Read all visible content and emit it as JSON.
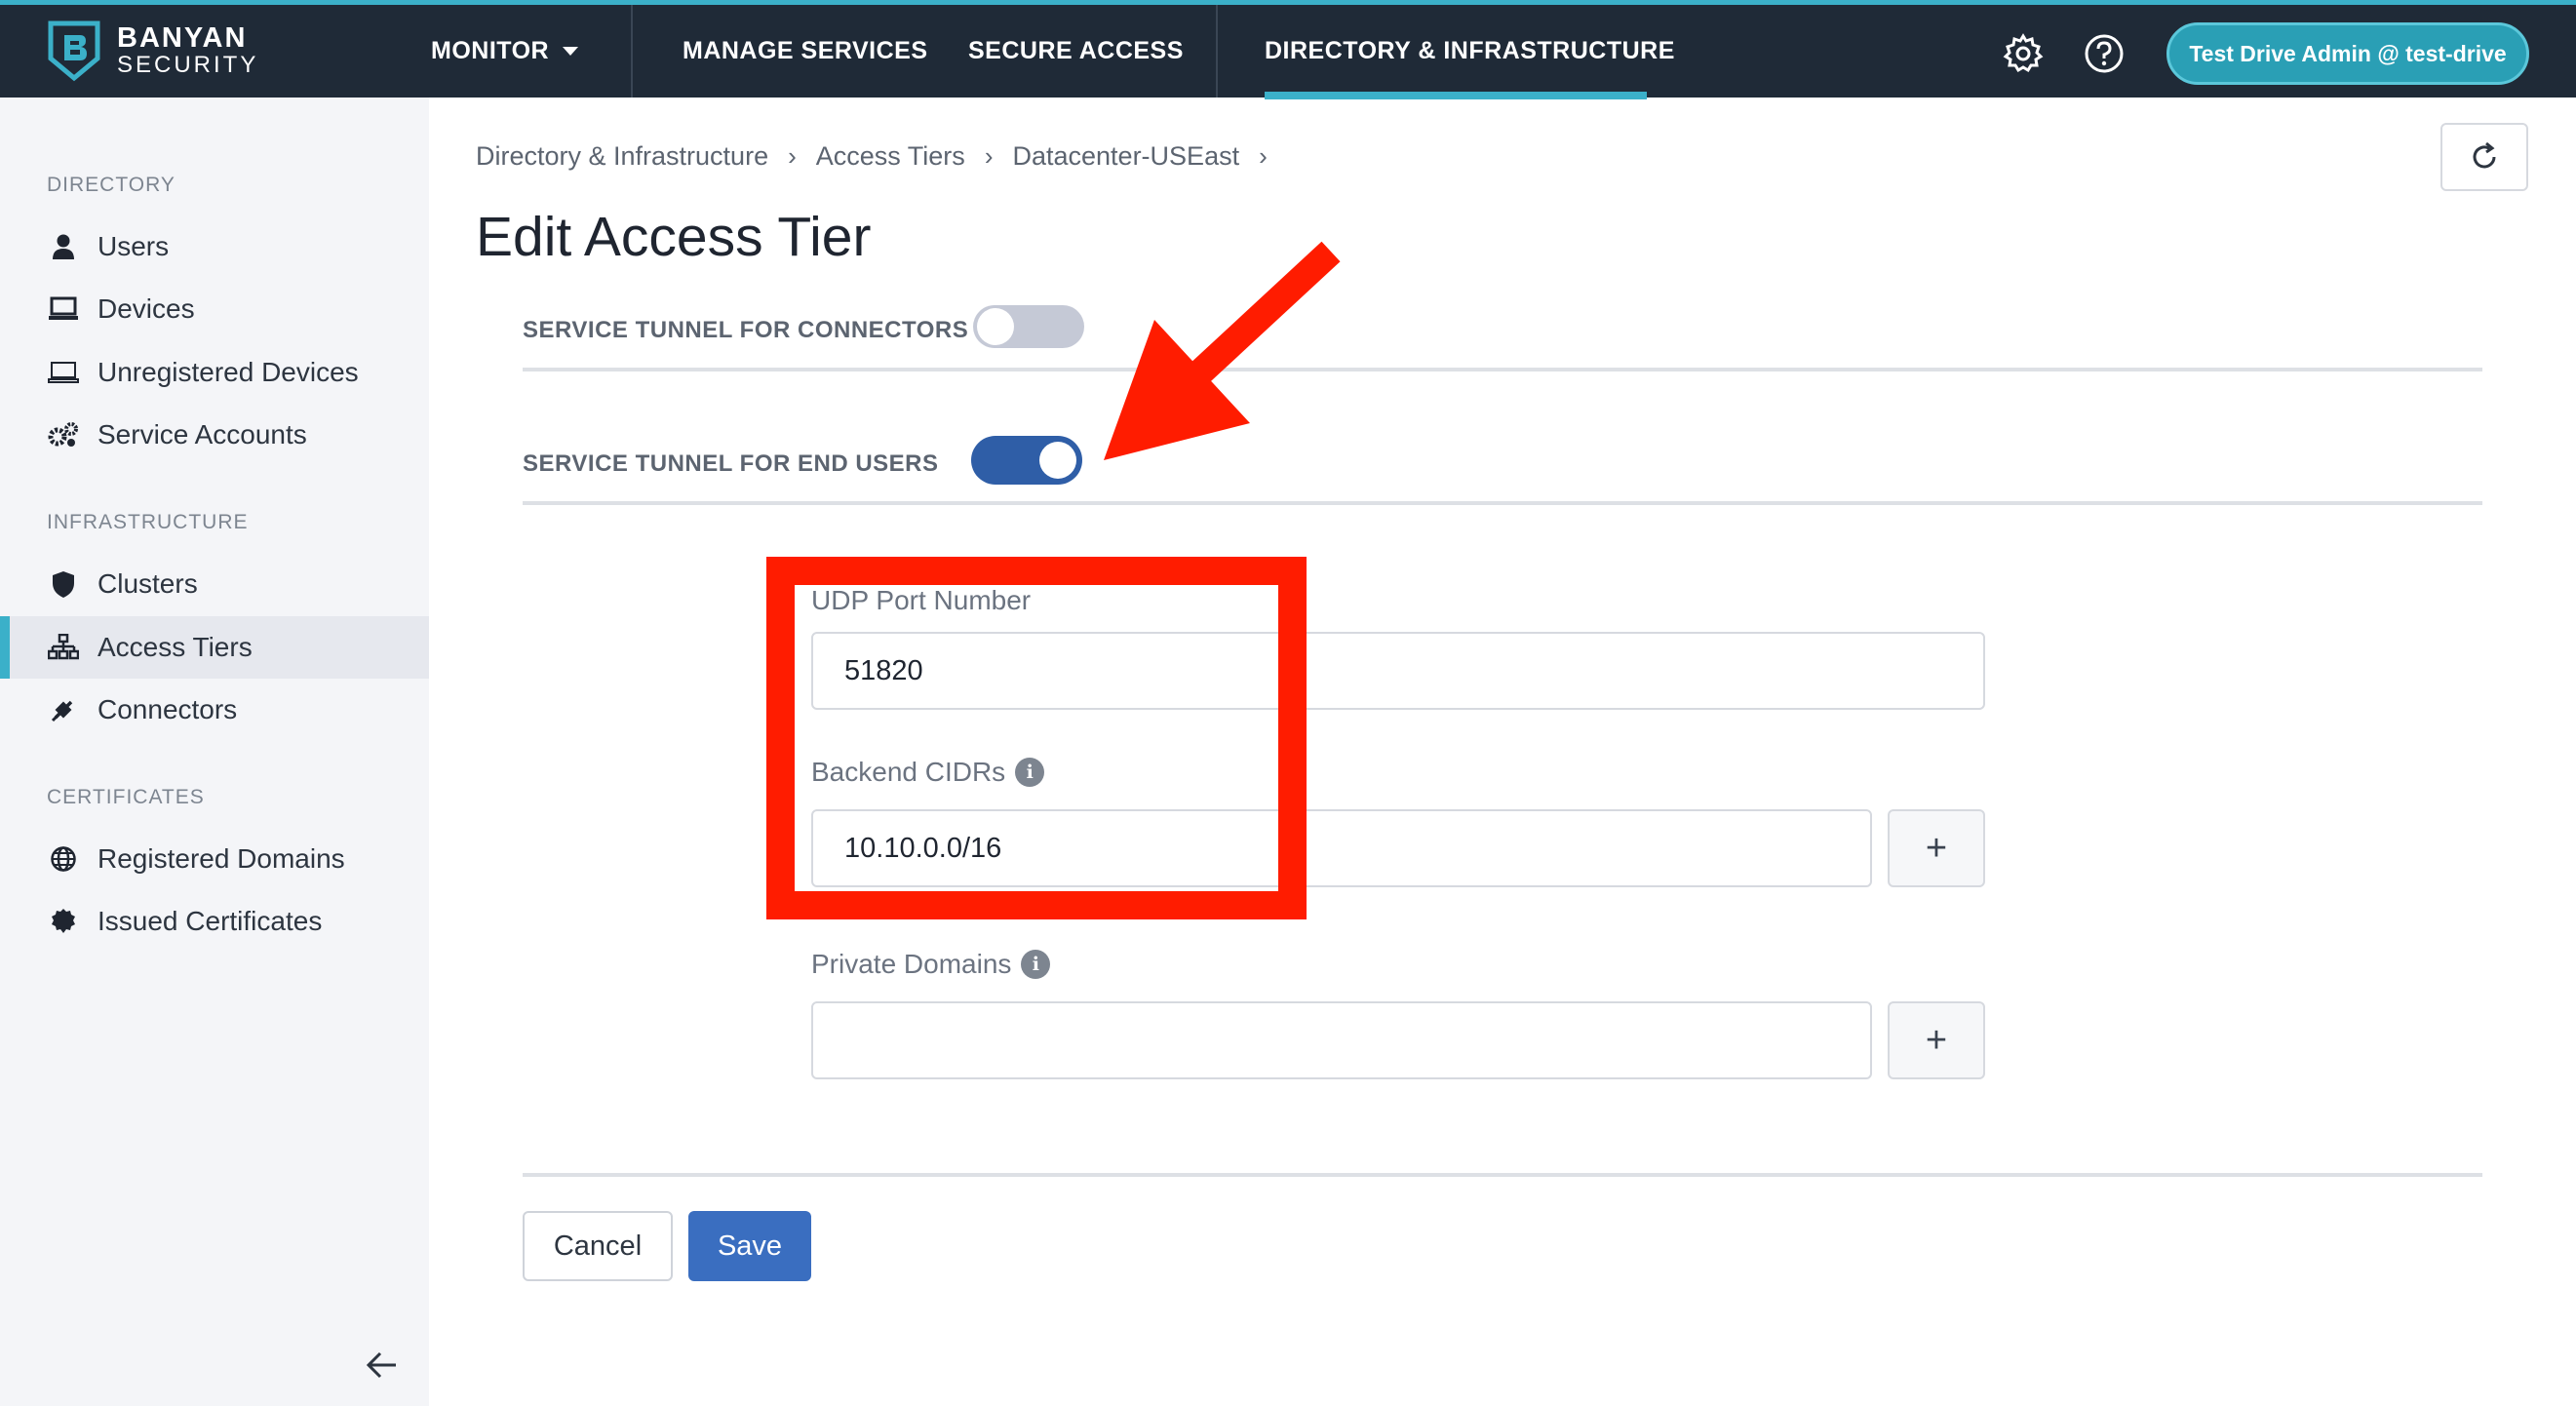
{
  "brand": {
    "line1": "BANYAN",
    "line2": "SECURITY"
  },
  "nav": {
    "monitor": "MONITOR",
    "manage_services": "MANAGE SERVICES",
    "secure_access": "SECURE ACCESS",
    "directory_infrastructure": "DIRECTORY & INFRASTRUCTURE"
  },
  "user": {
    "label": "Test Drive Admin @ test-drive"
  },
  "sidebar": {
    "directory_heading": "DIRECTORY",
    "directory_items": [
      "Users",
      "Devices",
      "Unregistered Devices",
      "Service Accounts"
    ],
    "infrastructure_heading": "INFRASTRUCTURE",
    "infrastructure_items": [
      "Clusters",
      "Access Tiers",
      "Connectors"
    ],
    "certificates_heading": "CERTIFICATES",
    "certificates_items": [
      "Registered Domains",
      "Issued Certificates"
    ],
    "active_item": "Access Tiers"
  },
  "breadcrumb": [
    "Directory & Infrastructure",
    "Access Tiers",
    "Datacenter-USEast"
  ],
  "page_title": "Edit Access Tier",
  "toggles": {
    "connectors": {
      "label": "SERVICE TUNNEL FOR CONNECTORS",
      "on": false
    },
    "end_users": {
      "label": "SERVICE TUNNEL FOR END USERS",
      "on": true
    }
  },
  "form": {
    "udp_port": {
      "label": "UDP Port Number",
      "value": "51820"
    },
    "backend_cidrs": {
      "label": "Backend CIDRs",
      "value": "10.10.0.0/16"
    },
    "private_domains": {
      "label": "Private Domains",
      "value": ""
    },
    "add_symbol": "+"
  },
  "actions": {
    "cancel": "Cancel",
    "save": "Save"
  },
  "colors": {
    "topbar": "#1f2a37",
    "accent": "#3bb0c9",
    "toggle_on": "#2f5ea7",
    "toggle_off": "#c5c9d6",
    "save": "#3a6ec0",
    "annotation": "#ff1c00"
  }
}
